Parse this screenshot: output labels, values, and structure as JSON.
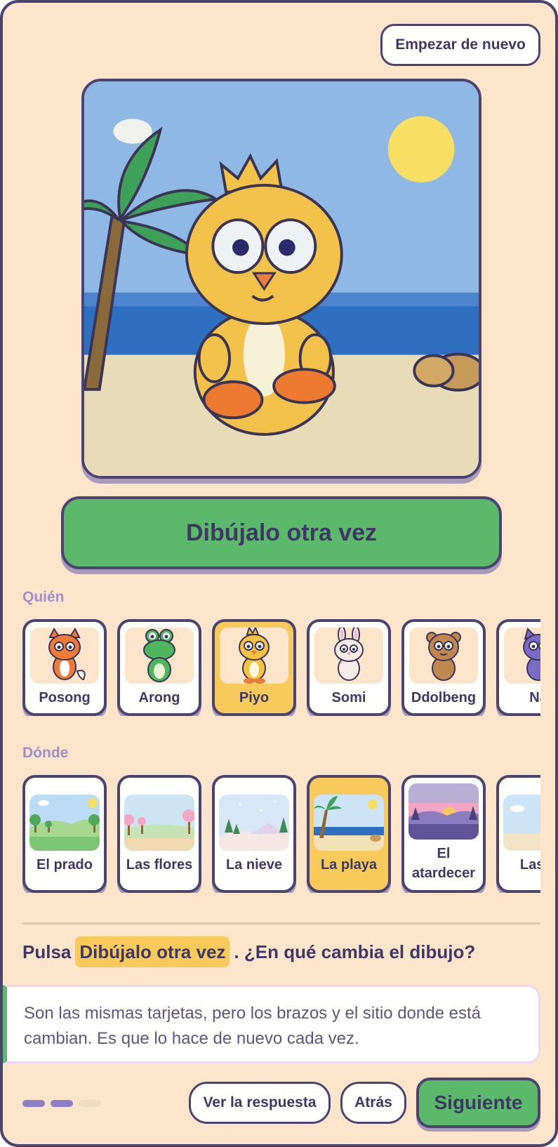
{
  "header": {
    "restart_label": "Empezar de nuevo"
  },
  "main": {
    "redraw_label": "Dibújalo otra vez"
  },
  "who": {
    "label": "Quién",
    "items": [
      {
        "name": "Posong",
        "color": "#f07a3a",
        "icon": "fox-icon",
        "selected": false
      },
      {
        "name": "Arong",
        "color": "#4fb55e",
        "icon": "frog-icon",
        "selected": false
      },
      {
        "name": "Piyo",
        "color": "#f5c340",
        "icon": "chick-icon",
        "selected": true
      },
      {
        "name": "Somi",
        "color": "#f7ece6",
        "icon": "rabbit-icon",
        "selected": false
      },
      {
        "name": "Ddolbeng",
        "color": "#c08850",
        "icon": "bear-icon",
        "selected": false
      },
      {
        "name": "Na",
        "color": "#7a6cc4",
        "icon": "cat-icon",
        "selected": false
      }
    ]
  },
  "where": {
    "label": "Dónde",
    "items": [
      {
        "name": "El prado",
        "icon": "meadow-icon",
        "selected": false
      },
      {
        "name": "Las flores",
        "icon": "flowers-icon",
        "selected": false
      },
      {
        "name": "La nieve",
        "icon": "snow-icon",
        "selected": false
      },
      {
        "name": "La playa",
        "icon": "beach-icon",
        "selected": true
      },
      {
        "name": "El atardecer",
        "icon": "sunset-icon",
        "selected": false
      },
      {
        "name": "Las n",
        "icon": "clouds-icon",
        "selected": false
      }
    ]
  },
  "question": {
    "prefix": "Pulsa",
    "highlight": "Dibújalo otra vez",
    "suffix": ". ¿En qué cambia el dibujo?"
  },
  "answer": {
    "text": "Son las mismas tarjetas, pero los brazos y el sitio donde está cambian. Es que lo hace de nuevo cada vez."
  },
  "progress": {
    "total": 3,
    "done": 2
  },
  "footer": {
    "show_answer_label": "Ver la respuesta",
    "back_label": "Atrás",
    "next_label": "Siguiente"
  },
  "colors": {
    "accent_green": "#5cb96b",
    "selected_yellow": "#f8c95b",
    "outline": "#4b4370",
    "background": "#fde5cb"
  }
}
